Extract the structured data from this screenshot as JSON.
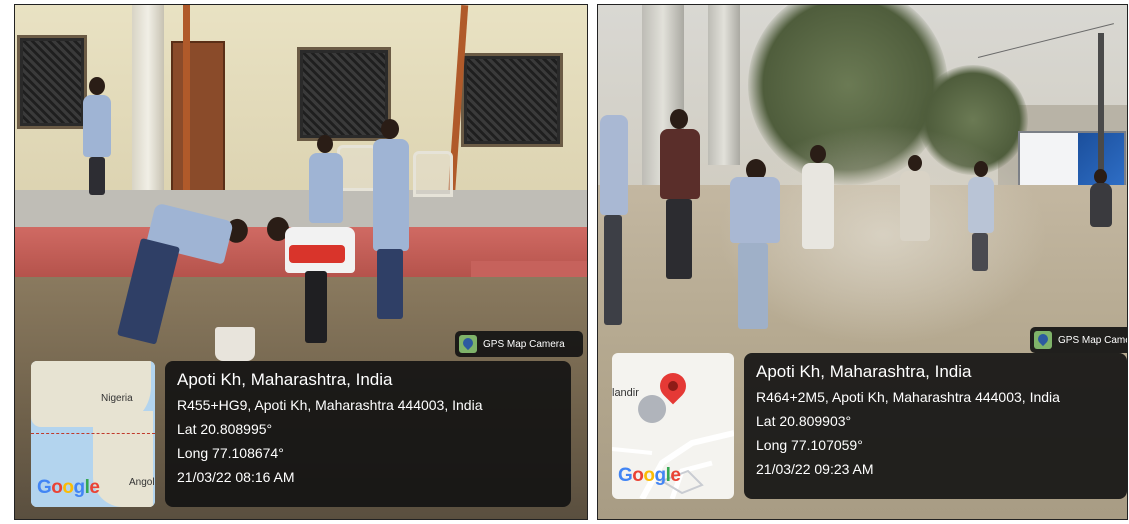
{
  "photos": [
    {
      "gps_tag_label": "GPS Map Camera",
      "map_labels": [
        "Nigeria",
        "Angol"
      ],
      "map_logo": "Google",
      "location_title": "Apoti Kh, Maharashtra, India",
      "address": "R455+HG9, Apoti Kh, Maharashtra 444003, India",
      "latitude": "Lat 20.808995°",
      "longitude": "Long 77.108674°",
      "timestamp": "21/03/22 08:16 AM"
    },
    {
      "gps_tag_label": "GPS Map Came",
      "map_labels": [
        "landir"
      ],
      "map_logo": "Google",
      "location_title": "Apoti Kh, Maharashtra, India",
      "address": "R464+2M5, Apoti Kh, Maharashtra 444003, India",
      "latitude": "Lat 20.809903°",
      "longitude": "Long 77.107059°",
      "timestamp": "21/03/22 09:23 AM"
    }
  ],
  "colors": {
    "panel_bg": "#121212",
    "map_pin": "#e53935",
    "uniform_shirt": "#9fb4d4",
    "uniform_dupatta": "#2f3f66"
  },
  "icons": [
    "gps-map-camera-icon",
    "map-pin-icon"
  ]
}
